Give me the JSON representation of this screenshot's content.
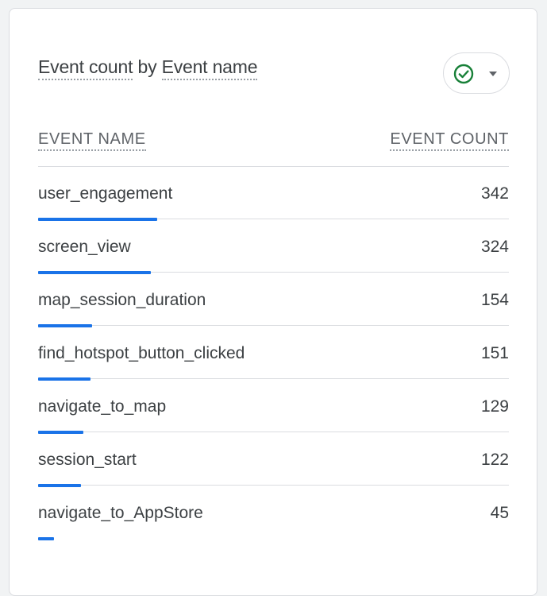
{
  "card": {
    "title_metric": "Event count",
    "title_by": " by ",
    "title_dimension": "Event name"
  },
  "compare_button": {
    "icon": "check-circle-icon",
    "icon_color": "#188038",
    "caret_icon": "caret-down-icon"
  },
  "table": {
    "col_name_header": "EVENT NAME",
    "col_count_header": "EVENT COUNT",
    "bar_color": "#1a73e8",
    "rows": [
      {
        "name": "user_engagement",
        "count": "342",
        "value": 342
      },
      {
        "name": "screen_view",
        "count": "324",
        "value": 324
      },
      {
        "name": "map_session_duration",
        "count": "154",
        "value": 154
      },
      {
        "name": "find_hotspot_button_clicked",
        "count": "151",
        "value": 151
      },
      {
        "name": "navigate_to_map",
        "count": "129",
        "value": 129
      },
      {
        "name": "session_start",
        "count": "122",
        "value": 122
      },
      {
        "name": "navigate_to_AppStore",
        "count": "45",
        "value": 45
      }
    ]
  }
}
